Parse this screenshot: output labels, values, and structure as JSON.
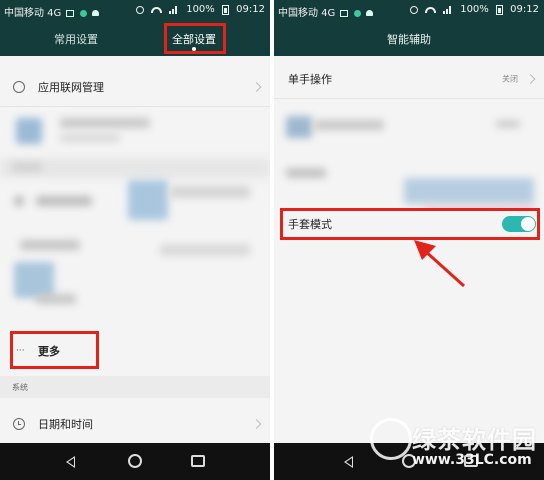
{
  "left_screen": {
    "status_bar": {
      "carrier": "中国移动 4G",
      "battery": "100%",
      "time": "09:12"
    },
    "tabs": {
      "common": "常用设置",
      "all": "全部设置"
    },
    "rows": {
      "app_network": "应用联网管理",
      "more": "更多",
      "date_time": "日期和时间"
    },
    "more_prefix": "···",
    "section_system": "系统"
  },
  "right_screen": {
    "status_bar": {
      "carrier": "中国移动 4G",
      "battery": "100%",
      "time": "09:12"
    },
    "title": "智能辅助",
    "rows": {
      "one_hand": "单手操作",
      "one_hand_value": "关闭",
      "glove_mode": "手套模式"
    },
    "glove_toggle_on": true
  },
  "watermark": {
    "logo_text": "绿茶软件园",
    "url": "www.33LC.com"
  },
  "colors": {
    "accent": "#2cb7b0",
    "highlight": "#e2231a",
    "appbar": "#143c3a"
  },
  "icons": [
    "network-icon",
    "clock-icon",
    "back-icon",
    "home-icon",
    "recent-apps-icon",
    "chevron-right-icon",
    "toggle-switch",
    "red-arrow"
  ]
}
